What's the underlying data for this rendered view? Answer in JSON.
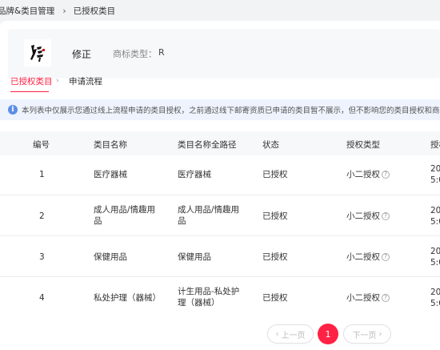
{
  "breadcrumb": {
    "parent": "品牌&类目管理",
    "separator": "›",
    "current": "已授权类目"
  },
  "brand": {
    "name": "修正",
    "trademark_label": "商标类型：",
    "trademark_value": "R"
  },
  "tabs": [
    {
      "label": "已授权类目",
      "active": true
    },
    {
      "label": "申请流程",
      "active": false
    }
  ],
  "tab_separator": "›",
  "notice": {
    "text": "本列表中仅展示您通过线上流程申请的类目授权，之前通过线下邮寄资质已申请的类目暂不展示，但不影响您的类目授权和商品发布，请勿重复"
  },
  "table": {
    "columns": [
      "编号",
      "类目名称",
      "类目名称全路径",
      "状态",
      "授权类型",
      "授权"
    ],
    "rows": [
      {
        "no": "1",
        "name": "医疗器械",
        "path": "医疗器械",
        "status": "已授权",
        "auth_type": "小二授权",
        "time_a": "20",
        "time_b": "5:0"
      },
      {
        "no": "2",
        "name": "成人用品/情趣用品",
        "path": "成人用品/情趣用品",
        "status": "已授权",
        "auth_type": "小二授权",
        "time_a": "20",
        "time_b": "5:0"
      },
      {
        "no": "3",
        "name": "保健用品",
        "path": "保健用品",
        "status": "已授权",
        "auth_type": "小二授权",
        "time_a": "20",
        "time_b": "5:0"
      },
      {
        "no": "4",
        "name": "私处护理（器械）",
        "path": "计生用品-私处护理（器械）",
        "status": "已授权",
        "auth_type": "小二授权",
        "time_a": "20",
        "time_b": "5:0"
      }
    ]
  },
  "help_icon": "question-circle-icon",
  "pagination": {
    "prev_label": "上一页",
    "current_page": "1",
    "next_label": "下一页"
  },
  "colors": {
    "accent": "#ff2244",
    "info": "#5b8ee6",
    "notice_bg": "#eef3fd"
  }
}
